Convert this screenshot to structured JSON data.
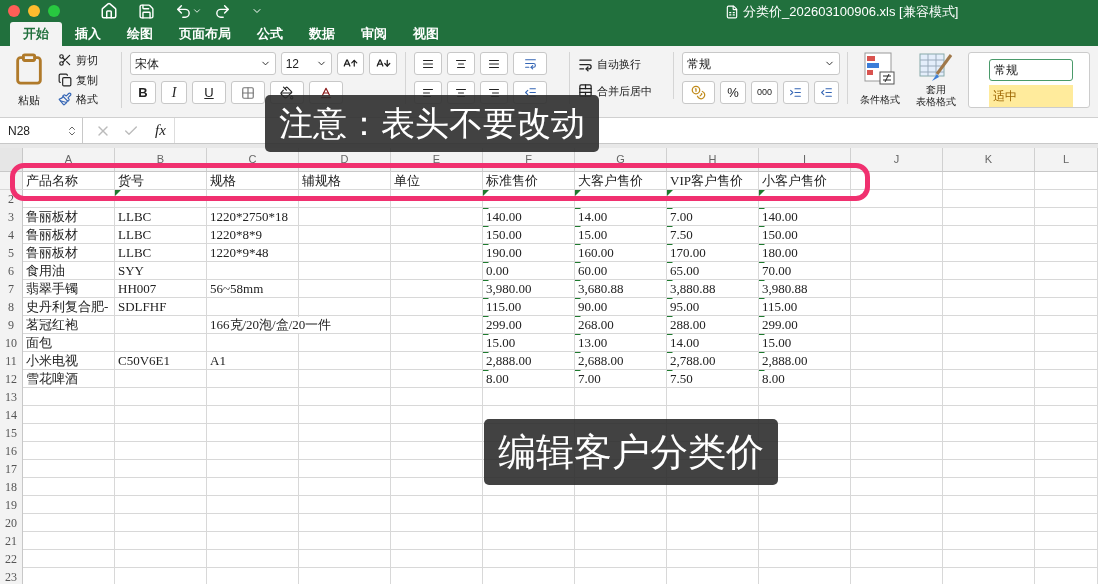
{
  "window": {
    "title": "分类价_202603100906.xls [兼容模式]"
  },
  "tabs": [
    {
      "label": "开始",
      "selected": true
    },
    {
      "label": "插入",
      "selected": false
    },
    {
      "label": "绘图",
      "selected": false
    },
    {
      "label": "页面布局",
      "selected": false
    },
    {
      "label": "公式",
      "selected": false
    },
    {
      "label": "数据",
      "selected": false
    },
    {
      "label": "审阅",
      "selected": false
    },
    {
      "label": "视图",
      "selected": false
    }
  ],
  "ribbon": {
    "clipboard": {
      "paste": "粘贴",
      "cut": "剪切",
      "copy": "复制",
      "format": "格式"
    },
    "font": {
      "name": "宋体",
      "size": "12",
      "bold": "B",
      "italic": "I",
      "underline": "U"
    },
    "alignment": {
      "wrap": "自动换行",
      "merge": "合并后居中"
    },
    "number": {
      "format": "常规",
      "percent": "%",
      "thousands": "000"
    },
    "styles": {
      "conditional": "条件格式",
      "table_lines": [
        "套用",
        "表格格式"
      ],
      "cell_styles": [
        {
          "label": "常规",
          "color": "#ffffff"
        },
        {
          "label": "适中",
          "color": "#ffeb9c"
        }
      ]
    }
  },
  "formula_bar": {
    "name_box": "N28",
    "fx": "fx"
  },
  "sheet": {
    "columns": [
      "A",
      "B",
      "C",
      "D",
      "E",
      "F",
      "G",
      "H",
      "I",
      "J",
      "K",
      "L"
    ],
    "rows": [
      {
        "cells": [
          {
            "text": "产品名称",
            "flag": false
          },
          {
            "text": "货号",
            "flag": false
          },
          {
            "text": "规格",
            "flag": false
          },
          {
            "text": "辅规格",
            "flag": false
          },
          {
            "text": "单位",
            "flag": false
          },
          {
            "text": "标准售价",
            "flag": false
          },
          {
            "text": "大客户售价",
            "flag": false
          },
          {
            "text": "VIP客户售价",
            "flag": false
          },
          {
            "text": "小客户售价",
            "flag": false
          }
        ]
      },
      {
        "n": "2",
        "cells": [
          {
            "flag": false
          },
          {
            "flag": true
          },
          {
            "flag": false
          },
          {
            "flag": false
          },
          {
            "flag": false
          },
          {
            "flag": true
          },
          {
            "flag": true
          },
          {
            "flag": true
          },
          {
            "flag": true
          }
        ]
      },
      {
        "n": "3",
        "cells": [
          {
            "text": "鲁丽板材",
            "flag": false
          },
          {
            "text": "LLBC",
            "flag": false
          },
          {
            "text": "1220*2750*18",
            "flag": false
          },
          {
            "flag": false
          },
          {
            "flag": false
          },
          {
            "text": "140.00",
            "flag": true
          },
          {
            "text": "14.00",
            "flag": true
          },
          {
            "text": "7.00",
            "flag": true
          },
          {
            "text": "140.00",
            "flag": true
          }
        ]
      },
      {
        "n": "4",
        "cells": [
          {
            "text": "鲁丽板材",
            "flag": false
          },
          {
            "text": "LLBC",
            "flag": false
          },
          {
            "text": "1220*8*9",
            "flag": false
          },
          {
            "flag": false
          },
          {
            "flag": false
          },
          {
            "text": "150.00",
            "flag": true
          },
          {
            "text": "15.00",
            "flag": true
          },
          {
            "text": "7.50",
            "flag": true
          },
          {
            "text": "150.00",
            "flag": true
          }
        ]
      },
      {
        "n": "5",
        "cells": [
          {
            "text": "鲁丽板材",
            "flag": false
          },
          {
            "text": "LLBC",
            "flag": false
          },
          {
            "text": "1220*9*48",
            "flag": false
          },
          {
            "flag": false
          },
          {
            "flag": false
          },
          {
            "text": "190.00",
            "flag": true
          },
          {
            "text": "160.00",
            "flag": true
          },
          {
            "text": "170.00",
            "flag": true
          },
          {
            "text": "180.00",
            "flag": true
          }
        ]
      },
      {
        "n": "6",
        "cells": [
          {
            "text": "食用油",
            "flag": false
          },
          {
            "text": "SYY",
            "flag": false
          },
          {
            "flag": false
          },
          {
            "flag": false
          },
          {
            "flag": false
          },
          {
            "text": "0.00",
            "flag": true
          },
          {
            "text": "60.00",
            "flag": true
          },
          {
            "text": "65.00",
            "flag": true
          },
          {
            "text": "70.00",
            "flag": true
          }
        ]
      },
      {
        "n": "7",
        "cells": [
          {
            "text": "翡翠手镯",
            "flag": false
          },
          {
            "text": "HH007",
            "flag": false
          },
          {
            "text": "56~58mm",
            "flag": false
          },
          {
            "flag": false
          },
          {
            "flag": false
          },
          {
            "text": "3,980.00",
            "flag": true
          },
          {
            "text": "3,680.88",
            "flag": true
          },
          {
            "text": "3,880.88",
            "flag": true
          },
          {
            "text": "3,980.88",
            "flag": true
          }
        ]
      },
      {
        "n": "8",
        "cells": [
          {
            "text": "史丹利复合肥-",
            "flag": false
          },
          {
            "text": "SDLFHF",
            "flag": false
          },
          {
            "flag": false
          },
          {
            "flag": false
          },
          {
            "flag": false
          },
          {
            "text": "115.00",
            "flag": true
          },
          {
            "text": "90.00",
            "flag": true
          },
          {
            "text": "95.00",
            "flag": true
          },
          {
            "text": "115.00",
            "flag": true
          }
        ]
      },
      {
        "n": "9",
        "cells": [
          {
            "text": "茗冠红袍",
            "flag": false
          },
          {
            "flag": false
          },
          {
            "text": "166克/20泡/盒/20一件",
            "flag": false
          },
          {
            "flag": false
          },
          {
            "flag": false
          },
          {
            "text": "299.00",
            "flag": true
          },
          {
            "text": "268.00",
            "flag": true
          },
          {
            "text": "288.00",
            "flag": true
          },
          {
            "text": "299.00",
            "flag": true
          }
        ]
      },
      {
        "n": "10",
        "cells": [
          {
            "text": "面包",
            "flag": false
          },
          {
            "flag": false
          },
          {
            "flag": false
          },
          {
            "flag": false
          },
          {
            "flag": false
          },
          {
            "text": "15.00",
            "flag": true
          },
          {
            "text": "13.00",
            "flag": true
          },
          {
            "text": "14.00",
            "flag": true
          },
          {
            "text": "15.00",
            "flag": true
          }
        ]
      },
      {
        "n": "11",
        "cells": [
          {
            "text": "小米电视",
            "flag": false
          },
          {
            "text": "C50V6E1",
            "flag": false
          },
          {
            "text": "A1",
            "flag": false
          },
          {
            "flag": false
          },
          {
            "flag": false
          },
          {
            "text": "2,888.00",
            "flag": true
          },
          {
            "text": "2,688.00",
            "flag": true
          },
          {
            "text": "2,788.00",
            "flag": true
          },
          {
            "text": "2,888.00",
            "flag": true
          }
        ]
      },
      {
        "n": "12",
        "cells": [
          {
            "text": "雪花啤酒",
            "flag": false
          },
          {
            "flag": false
          },
          {
            "flag": false
          },
          {
            "flag": false
          },
          {
            "flag": false
          },
          {
            "text": "8.00",
            "flag": true
          },
          {
            "text": "7.00",
            "flag": true
          },
          {
            "text": "7.50",
            "flag": true
          },
          {
            "text": "8.00",
            "flag": true
          }
        ]
      },
      {
        "n": "13"
      },
      {
        "n": "14"
      },
      {
        "n": "15"
      },
      {
        "n": "16"
      },
      {
        "n": "17"
      },
      {
        "n": "18"
      },
      {
        "n": "19"
      },
      {
        "n": "20"
      },
      {
        "n": "21"
      },
      {
        "n": "22"
      },
      {
        "n": "23"
      }
    ]
  },
  "captions": [
    "注意：表头不要改动",
    "编辑客户分类价"
  ]
}
